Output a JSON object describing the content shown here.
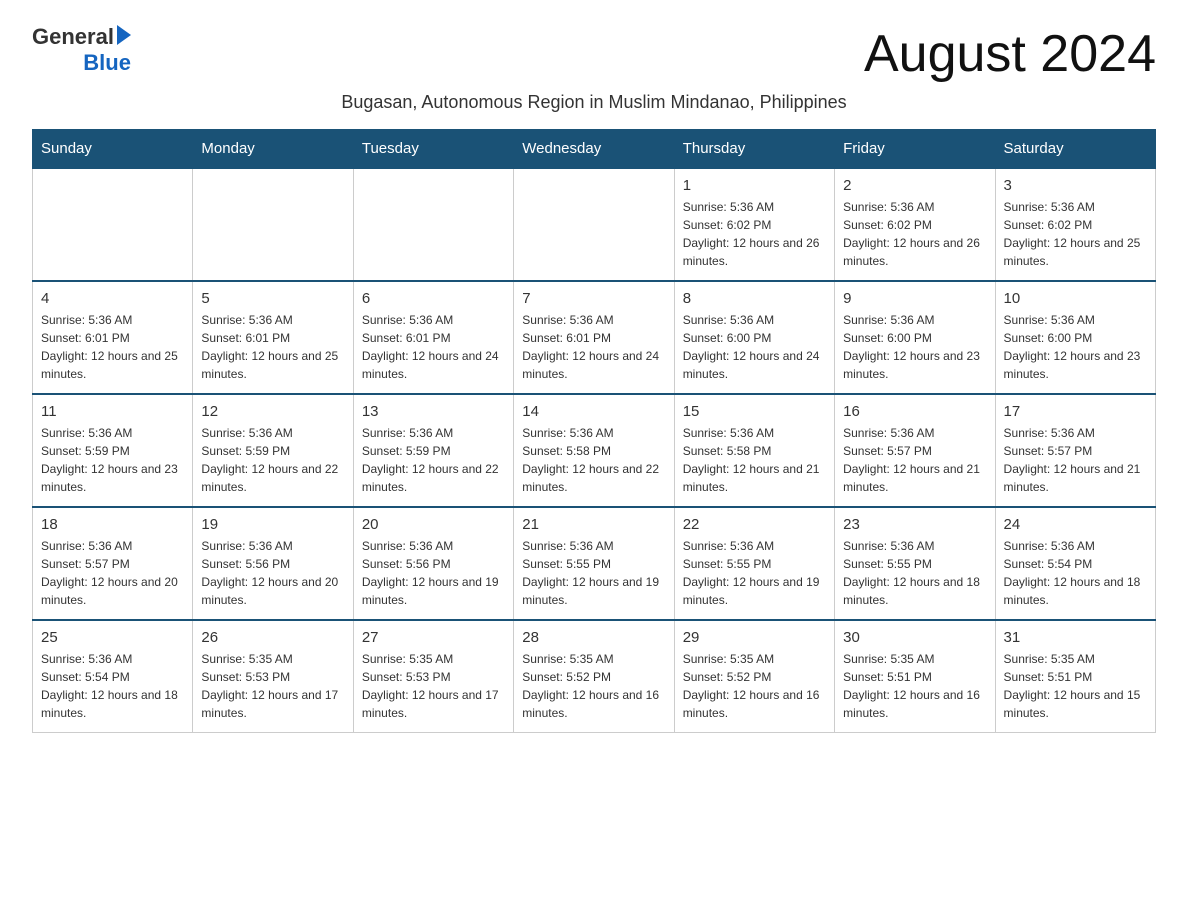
{
  "header": {
    "title": "August 2024",
    "subtitle": "Bugasan, Autonomous Region in Muslim Mindanao, Philippines",
    "logo_general": "General",
    "logo_blue": "Blue"
  },
  "weekdays": [
    "Sunday",
    "Monday",
    "Tuesday",
    "Wednesday",
    "Thursday",
    "Friday",
    "Saturday"
  ],
  "weeks": [
    [
      {
        "day": "",
        "info": ""
      },
      {
        "day": "",
        "info": ""
      },
      {
        "day": "",
        "info": ""
      },
      {
        "day": "",
        "info": ""
      },
      {
        "day": "1",
        "info": "Sunrise: 5:36 AM\nSunset: 6:02 PM\nDaylight: 12 hours and 26 minutes."
      },
      {
        "day": "2",
        "info": "Sunrise: 5:36 AM\nSunset: 6:02 PM\nDaylight: 12 hours and 26 minutes."
      },
      {
        "day": "3",
        "info": "Sunrise: 5:36 AM\nSunset: 6:02 PM\nDaylight: 12 hours and 25 minutes."
      }
    ],
    [
      {
        "day": "4",
        "info": "Sunrise: 5:36 AM\nSunset: 6:01 PM\nDaylight: 12 hours and 25 minutes."
      },
      {
        "day": "5",
        "info": "Sunrise: 5:36 AM\nSunset: 6:01 PM\nDaylight: 12 hours and 25 minutes."
      },
      {
        "day": "6",
        "info": "Sunrise: 5:36 AM\nSunset: 6:01 PM\nDaylight: 12 hours and 24 minutes."
      },
      {
        "day": "7",
        "info": "Sunrise: 5:36 AM\nSunset: 6:01 PM\nDaylight: 12 hours and 24 minutes."
      },
      {
        "day": "8",
        "info": "Sunrise: 5:36 AM\nSunset: 6:00 PM\nDaylight: 12 hours and 24 minutes."
      },
      {
        "day": "9",
        "info": "Sunrise: 5:36 AM\nSunset: 6:00 PM\nDaylight: 12 hours and 23 minutes."
      },
      {
        "day": "10",
        "info": "Sunrise: 5:36 AM\nSunset: 6:00 PM\nDaylight: 12 hours and 23 minutes."
      }
    ],
    [
      {
        "day": "11",
        "info": "Sunrise: 5:36 AM\nSunset: 5:59 PM\nDaylight: 12 hours and 23 minutes."
      },
      {
        "day": "12",
        "info": "Sunrise: 5:36 AM\nSunset: 5:59 PM\nDaylight: 12 hours and 22 minutes."
      },
      {
        "day": "13",
        "info": "Sunrise: 5:36 AM\nSunset: 5:59 PM\nDaylight: 12 hours and 22 minutes."
      },
      {
        "day": "14",
        "info": "Sunrise: 5:36 AM\nSunset: 5:58 PM\nDaylight: 12 hours and 22 minutes."
      },
      {
        "day": "15",
        "info": "Sunrise: 5:36 AM\nSunset: 5:58 PM\nDaylight: 12 hours and 21 minutes."
      },
      {
        "day": "16",
        "info": "Sunrise: 5:36 AM\nSunset: 5:57 PM\nDaylight: 12 hours and 21 minutes."
      },
      {
        "day": "17",
        "info": "Sunrise: 5:36 AM\nSunset: 5:57 PM\nDaylight: 12 hours and 21 minutes."
      }
    ],
    [
      {
        "day": "18",
        "info": "Sunrise: 5:36 AM\nSunset: 5:57 PM\nDaylight: 12 hours and 20 minutes."
      },
      {
        "day": "19",
        "info": "Sunrise: 5:36 AM\nSunset: 5:56 PM\nDaylight: 12 hours and 20 minutes."
      },
      {
        "day": "20",
        "info": "Sunrise: 5:36 AM\nSunset: 5:56 PM\nDaylight: 12 hours and 19 minutes."
      },
      {
        "day": "21",
        "info": "Sunrise: 5:36 AM\nSunset: 5:55 PM\nDaylight: 12 hours and 19 minutes."
      },
      {
        "day": "22",
        "info": "Sunrise: 5:36 AM\nSunset: 5:55 PM\nDaylight: 12 hours and 19 minutes."
      },
      {
        "day": "23",
        "info": "Sunrise: 5:36 AM\nSunset: 5:55 PM\nDaylight: 12 hours and 18 minutes."
      },
      {
        "day": "24",
        "info": "Sunrise: 5:36 AM\nSunset: 5:54 PM\nDaylight: 12 hours and 18 minutes."
      }
    ],
    [
      {
        "day": "25",
        "info": "Sunrise: 5:36 AM\nSunset: 5:54 PM\nDaylight: 12 hours and 18 minutes."
      },
      {
        "day": "26",
        "info": "Sunrise: 5:35 AM\nSunset: 5:53 PM\nDaylight: 12 hours and 17 minutes."
      },
      {
        "day": "27",
        "info": "Sunrise: 5:35 AM\nSunset: 5:53 PM\nDaylight: 12 hours and 17 minutes."
      },
      {
        "day": "28",
        "info": "Sunrise: 5:35 AM\nSunset: 5:52 PM\nDaylight: 12 hours and 16 minutes."
      },
      {
        "day": "29",
        "info": "Sunrise: 5:35 AM\nSunset: 5:52 PM\nDaylight: 12 hours and 16 minutes."
      },
      {
        "day": "30",
        "info": "Sunrise: 5:35 AM\nSunset: 5:51 PM\nDaylight: 12 hours and 16 minutes."
      },
      {
        "day": "31",
        "info": "Sunrise: 5:35 AM\nSunset: 5:51 PM\nDaylight: 12 hours and 15 minutes."
      }
    ]
  ]
}
